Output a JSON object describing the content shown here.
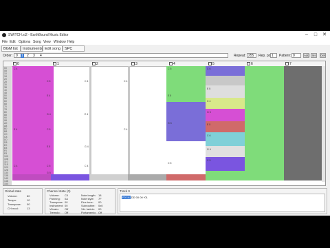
{
  "window": {
    "title": "SWITCH.st2 - EarthBound Music Editor",
    "min": "–",
    "max": "□",
    "close": "✕"
  },
  "menu": [
    "File",
    "Edit",
    "Options",
    "Song",
    "View",
    "Window",
    "Help"
  ],
  "tabs": [
    "BGM list",
    "Instruments",
    "Edit song",
    "SPC packs"
  ],
  "order": {
    "label": "Order:",
    "items": [
      "0",
      "1",
      "2",
      "3",
      "4"
    ],
    "selected_index": 1
  },
  "repeat": {
    "label": "Repeat:",
    "value": "255",
    "pos_label": "Rep. pos:",
    "pos_value": "1"
  },
  "pattern": {
    "label": "Pattern:",
    "value": "0",
    "buttons": [
      "Add",
      "Ins",
      "Del"
    ]
  },
  "channels": [
    "0",
    "1",
    "2",
    "3",
    "4",
    "5",
    "6",
    "7"
  ],
  "row_numbers": [
    "00",
    "08",
    "10",
    "18",
    "20",
    "28",
    "30",
    "38",
    "40",
    "48",
    "50",
    "58",
    "60",
    "68",
    "70",
    "78",
    "80",
    "88",
    "90",
    "98",
    "A0",
    "A8",
    "B0",
    "B8",
    "C0",
    "C8",
    "D0",
    "D8",
    "E0",
    "E8",
    "F0",
    "F8",
    "100",
    "108",
    "110",
    "118",
    "120",
    "128",
    "130",
    "138",
    "140",
    "148",
    "150",
    "158"
  ],
  "cells": {
    "c0": [
      "C 4",
      "E 4",
      "C 4"
    ],
    "c1": [
      "C 5",
      "E 4",
      "G 4",
      "C 5",
      "E 5",
      "C 5",
      "G 5"
    ],
    "c2": [
      "C 4",
      "E 4",
      "G 4",
      "C 4"
    ],
    "c3": [
      "C 4",
      "C 4"
    ],
    "c4": [
      "C 5",
      "E 5",
      "G 5",
      "C 5"
    ],
    "c5": [
      "C 6",
      "E 5",
      "C 4",
      "G 5",
      "E 5",
      "C 6",
      "G 4",
      "C 5"
    ]
  },
  "global_state": {
    "title": "Global state",
    "rows": [
      [
        "Volume:",
        "80"
      ],
      [
        "Tempo:",
        "10"
      ],
      [
        "Transpose:",
        "00"
      ],
      [
        "CH mod:",
        "13"
      ]
    ]
  },
  "channel_state": {
    "title": "Channel state (0)",
    "left": [
      [
        "Volume:",
        "C0"
      ],
      [
        "Panning:",
        "0A"
      ],
      [
        "Transpose:",
        "00"
      ],
      [
        "Instrument:",
        "00"
      ],
      [
        "Vibrato:",
        "Off"
      ],
      [
        "Tremolo:",
        "Off"
      ]
    ],
    "right": [
      [
        "Note length:",
        "18"
      ],
      [
        "Note style:",
        "7F"
      ],
      [
        "Fine tune:",
        "00"
      ],
      [
        "Subroutine:",
        "0x0"
      ],
      [
        "Vib. fadein:",
        "00"
      ],
      [
        "Portamento:",
        "Off"
      ]
    ]
  },
  "track": {
    "title": "Track 0",
    "selected": "F0 1A",
    "rest": "DD 00 00 *01"
  },
  "colors": {
    "ch0": "#d64fd4",
    "ch1": "#7a55e0",
    "ch4": "#7fdc7a",
    "ch4b": "#7a6ed8",
    "ch6": "#7fdc7a",
    "ch7": "#6e6e6e",
    "accent": "#3a7bd5"
  }
}
